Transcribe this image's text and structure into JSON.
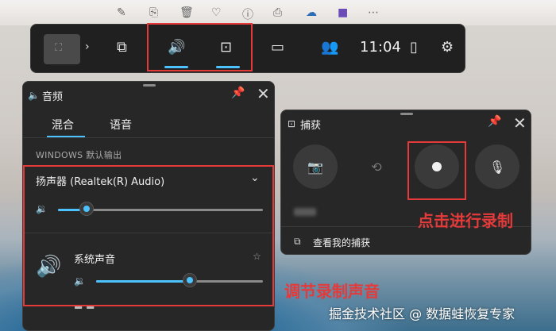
{
  "top_icons": [
    "pen-icon",
    "copy-icon",
    "trash-icon",
    "heart-icon",
    "info-icon",
    "print-icon",
    "cloud-icon",
    "app-icon",
    "more-icon"
  ],
  "gamebar": {
    "time": "11:04",
    "items": [
      "widget-menu-icon",
      "audio-icon",
      "capture-icon",
      "performance-icon",
      "social-icon",
      "mouse-icon",
      "settings-icon"
    ]
  },
  "audio_panel": {
    "title": "音频",
    "tabs": [
      "混合",
      "语音"
    ],
    "section_label": "WINDOWS 默认输出",
    "device": "扬声器 (Realtek(R) Audio)",
    "device_volume": 0.14,
    "app_name": "系统声音",
    "app_volume": 0.56
  },
  "capture_panel": {
    "title": "捕获",
    "link": "查看我的捕获"
  },
  "annotations": {
    "record": "点击进行录制",
    "adjust": "调节录制声音"
  },
  "watermark": "掘金技术社区 @ 数据蛙恢复专家",
  "colors": {
    "accent": "#4cc2ff",
    "annotation": "#e53a3a",
    "panel_bg": "#272727"
  }
}
